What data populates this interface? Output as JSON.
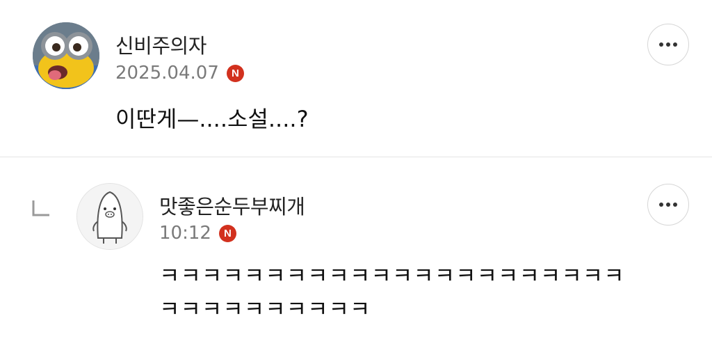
{
  "comments": [
    {
      "author": "신비주의자",
      "date": "2025.04.07",
      "badge": "N",
      "text": "이딴게—....소설....?"
    },
    {
      "author": "맛좋은순두부찌개",
      "date": "10:12",
      "badge": "N",
      "text_line1": "ㅋㅋㅋㅋㅋㅋㅋㅋㅋㅋㅋㅋㅋㅋㅋㅋㅋㅋㅋㅋㅋㅋ",
      "text_line2": "ㅋㅋㅋㅋㅋㅋㅋㅋㅋㅋ"
    }
  ],
  "icons": {
    "more": "more-horizontal-icon",
    "reply": "reply-arrow-icon",
    "badge": "naver-n-badge-icon"
  },
  "colors": {
    "badge": "#d2311e",
    "divider": "#e4e4e4",
    "meta_text": "#7a7a7a"
  }
}
